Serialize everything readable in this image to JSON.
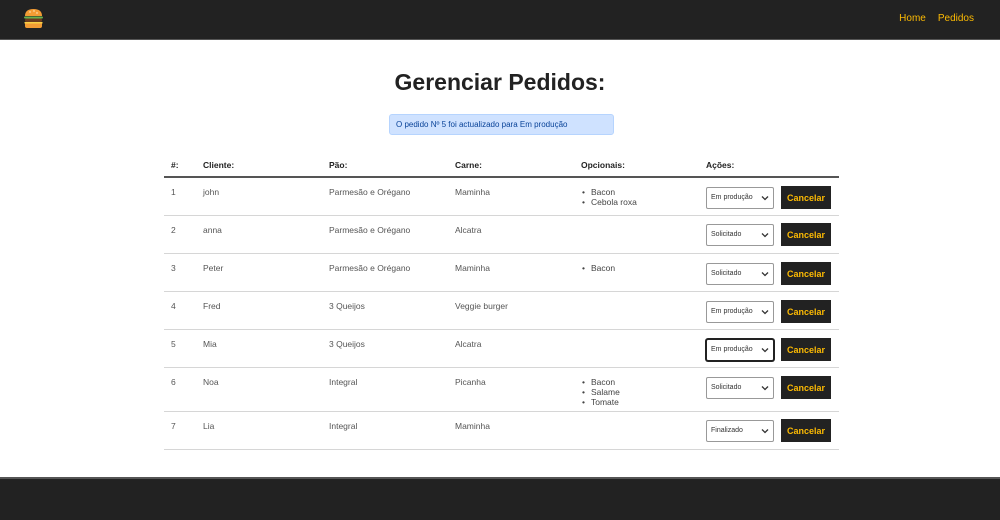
{
  "nav": {
    "home": "Home",
    "orders": "Pedidos"
  },
  "title": "Gerenciar Pedidos:",
  "alert": "O pedido Nº 5 foi actualizado para Em produção",
  "headers": [
    "#:",
    "Cliente:",
    "Pão:",
    "Carne:",
    "Opcionais:",
    "Ações:"
  ],
  "cancel_label": "Cancelar",
  "orders": [
    {
      "id": "1",
      "client": "john",
      "bread": "Parmesão e Orégano",
      "meat": "Maminha",
      "extras": [
        "Bacon",
        "Cebola roxa"
      ],
      "status": "Em produção"
    },
    {
      "id": "2",
      "client": "anna",
      "bread": "Parmesão e Orégano",
      "meat": "Alcatra",
      "extras": [],
      "status": "Solicitado"
    },
    {
      "id": "3",
      "client": "Peter",
      "bread": "Parmesão e Orégano",
      "meat": "Maminha",
      "extras": [
        "Bacon"
      ],
      "status": "Solicitado"
    },
    {
      "id": "4",
      "client": "Fred",
      "bread": "3 Queijos",
      "meat": "Veggie burger",
      "extras": [],
      "status": "Em produção"
    },
    {
      "id": "5",
      "client": "Mia",
      "bread": "3 Queijos",
      "meat": "Alcatra",
      "extras": [],
      "status": "Em produção"
    },
    {
      "id": "6",
      "client": "Noa",
      "bread": "Integral",
      "meat": "Picanha",
      "extras": [
        "Bacon",
        "Salame",
        "Tomate"
      ],
      "status": "Solicitado"
    },
    {
      "id": "7",
      "client": "Lia",
      "bread": "Integral",
      "meat": "Maminha",
      "extras": [],
      "status": "Finalizado"
    }
  ],
  "colors": {
    "dark": "#222222",
    "accent": "#fcba03",
    "alert_bg": "#cfe2ff"
  }
}
